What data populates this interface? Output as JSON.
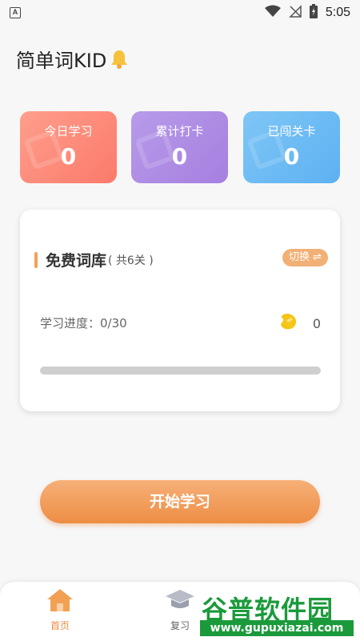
{
  "status_bar": {
    "badge": "A",
    "time": "5:05",
    "icons": [
      "wifi-icon",
      "no-signal-icon",
      "battery-charging-icon"
    ]
  },
  "header": {
    "title": "简单词KID",
    "icon": "bell-icon"
  },
  "stats": [
    {
      "label": "今日学习",
      "value": "0",
      "color": "#fb7a6b"
    },
    {
      "label": "累计打卡",
      "value": "0",
      "color": "#a67fe0"
    },
    {
      "label": "已闯关卡",
      "value": "0",
      "color": "#5db1f2"
    }
  ],
  "library": {
    "title": "免费词库",
    "count": "( 共6关 )",
    "switch_label": "切换 ⇌",
    "progress_text": "学习进度：0/30",
    "progress_value": 0,
    "bean_icon": "bean-icon",
    "bean_count": "0"
  },
  "start_button": "开始学习",
  "tabs": [
    {
      "label": "首页",
      "icon": "home-icon",
      "active": true
    },
    {
      "label": "复习",
      "icon": "graduation-cap-icon",
      "active": false
    }
  ],
  "watermark": {
    "title": "谷普软件园",
    "url": "www.gupuxiazai.com"
  },
  "colors": {
    "accent": "#ee8d44",
    "card1": "#fb7a6b",
    "card2": "#a67fe0",
    "card3": "#5db1f2"
  }
}
